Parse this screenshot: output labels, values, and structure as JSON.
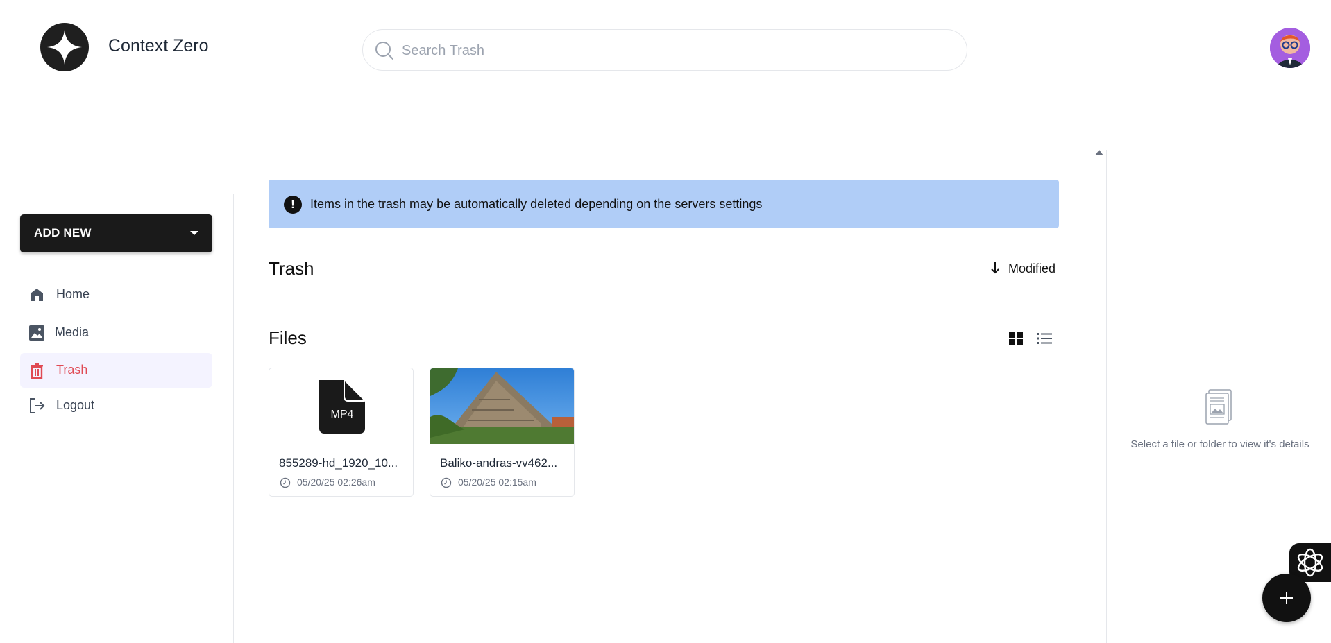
{
  "header": {
    "app_name": "Context Zero",
    "search_placeholder": "Search Trash",
    "search_value": ""
  },
  "sidebar": {
    "add_new_label": "ADD NEW",
    "items": [
      {
        "label": "Home",
        "icon": "home-icon"
      },
      {
        "label": "Media",
        "icon": "image-icon"
      },
      {
        "label": "Trash",
        "icon": "trash-icon",
        "active": true
      },
      {
        "label": "Logout",
        "icon": "logout-icon"
      }
    ]
  },
  "banner": {
    "icon": "alert-icon",
    "text": "Items in the trash may be automatically deleted depending on the servers settings"
  },
  "main": {
    "title": "Trash",
    "sort_label": "Modified",
    "files_title": "Files",
    "files": [
      {
        "name": "855289-hd_1920_10...",
        "date": "05/20/25 02:26am",
        "type_badge": "MP4"
      },
      {
        "name": "Baliko-andras-vv462...",
        "date": "05/20/25 02:15am"
      }
    ]
  },
  "details": {
    "empty_text": "Select a file or folder to view it's details"
  },
  "colors": {
    "accent_dark": "#1a1a1a",
    "banner_bg": "#b0cdf7",
    "active_nav_bg": "#f4f3ff",
    "active_nav_text": "#e04a54"
  }
}
